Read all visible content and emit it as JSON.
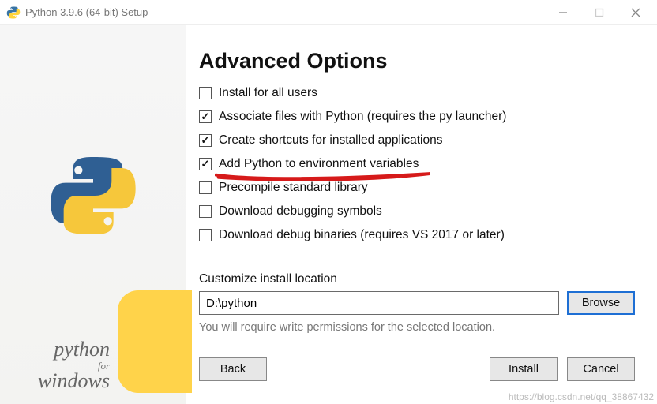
{
  "titlebar": {
    "title": "Python 3.9.6 (64-bit) Setup"
  },
  "sidebar": {
    "python": "python",
    "for": "for",
    "windows": "windows"
  },
  "heading": "Advanced Options",
  "options": [
    {
      "label": "Install for all users",
      "checked": false
    },
    {
      "label": "Associate files with Python (requires the py launcher)",
      "checked": true
    },
    {
      "label": "Create shortcuts for installed applications",
      "checked": true
    },
    {
      "label": "Add Python to environment variables",
      "checked": true,
      "highlighted": true
    },
    {
      "label": "Precompile standard library",
      "checked": false
    },
    {
      "label": "Download debugging symbols",
      "checked": false
    },
    {
      "label": "Download debug binaries (requires VS 2017 or later)",
      "checked": false
    }
  ],
  "location": {
    "label": "Customize install location",
    "value": "D:\\python",
    "browse": "Browse",
    "hint": "You will require write permissions for the selected location."
  },
  "buttons": {
    "back": "Back",
    "install": "Install",
    "cancel": "Cancel"
  },
  "watermark": "https://blog.csdn.net/qq_38867432"
}
